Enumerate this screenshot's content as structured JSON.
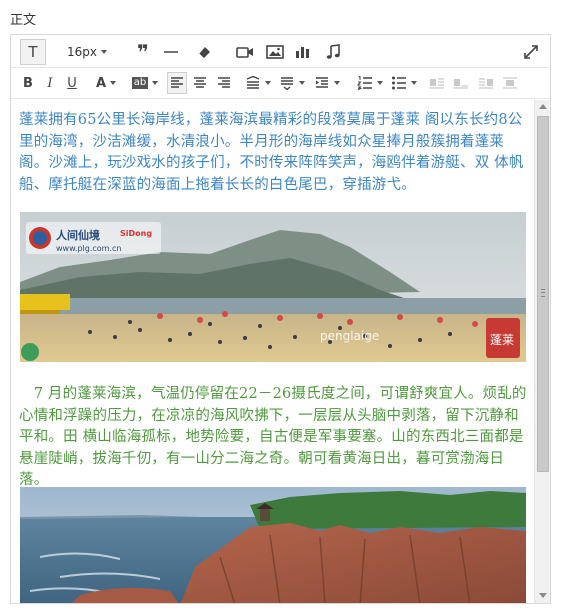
{
  "section": {
    "label": "正文"
  },
  "toolbar": {
    "text_style_label": "T",
    "font_size": "16px",
    "quote_label": "❞",
    "bold_label": "B",
    "italic_label": "I",
    "underline_label": "U",
    "font_color_label": "A",
    "bg_color_label": "ab"
  },
  "content": {
    "paragraph1": "蓬莱拥有65公里长海岸线，蓬莱海滨最精彩的段落莫属于蓬莱 阁以东长约8公里的海湾，沙洁滩缓，水清浪小。半月形的海岸线如众星捧月般簇拥着蓬莱阁。沙滩上，玩沙戏水的孩子们，不时传来阵阵笑声，海鸥伴着游艇、双 体帆船、摩托艇在深蓝的海面上拖着长长的白色尾巴，穿插游弋。",
    "paragraph2": "　7 月的蓬莱海滨，气温仍停留在22－26摄氏度之间，可谓舒爽宜人。烦乱的心情和浮躁的压力，在凉凉的海风吹拂下，一层层从头脑中剥落，留下沉静和平和。田 横山临海孤标，地势险要，自古便是军事要塞。山的东西北三面都是悬崖陡峭，拔海千仞，有一山分二海之奇。朝可看黄海日出，暮可赏渤海日落。",
    "photo1": {
      "logo_text": "人间仙境",
      "site_text": "www.plg.com.cn",
      "brand_text": "SiDong",
      "watermark": "penglaige",
      "seal": "蓬莱"
    }
  },
  "colors": {
    "paragraph1": "#3d86c6",
    "paragraph2": "#4e9a3c"
  }
}
